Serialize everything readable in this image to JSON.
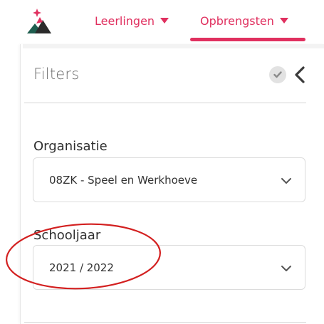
{
  "header": {
    "nav": [
      {
        "label": "Leerlingen"
      },
      {
        "label": "Opbrengsten",
        "active": true
      }
    ],
    "accent_color": "#e0305f"
  },
  "filters_panel": {
    "title": "Filters",
    "fields": [
      {
        "label": "Organisatie",
        "value": "08ZK - Speel en Werkhoeve"
      },
      {
        "label": "Schooljaar",
        "value": "2021 / 2022"
      }
    ]
  },
  "annotation": {
    "shape": "ellipse",
    "color": "#d32020",
    "highlights": "Schooljaar"
  }
}
